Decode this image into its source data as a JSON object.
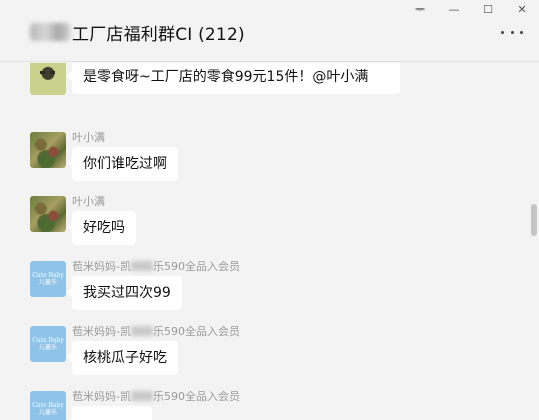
{
  "window": {
    "pin_glyph": "ᆓ",
    "minimize_glyph": "—",
    "maximize_glyph": "☐",
    "close_glyph": "✕"
  },
  "header": {
    "title": "工厂店福利群CI (212)",
    "more_icon": "more-dots-icon"
  },
  "messages": [
    {
      "sender": "",
      "avatar": "green-face-avatar",
      "text": "是零食呀~工厂店的零食99元15件！@叶小满"
    },
    {
      "sender": "叶小满",
      "avatar": "photo-avatar",
      "text": "你们谁吃过啊"
    },
    {
      "sender": "叶小满",
      "avatar": "photo-avatar",
      "text": "好吃吗"
    },
    {
      "sender_prefix": "苞米妈妈-凯",
      "sender_suffix": "乐590全品入会员",
      "avatar": "blue-logo-avatar",
      "avatar_text_1": "Cute Baby",
      "avatar_text_2": "儿童乐",
      "text": "我买过四次99"
    },
    {
      "sender_prefix": "苞米妈妈-凯",
      "sender_suffix": "乐590全品入会员",
      "avatar": "blue-logo-avatar",
      "avatar_text_1": "Cute Baby",
      "avatar_text_2": "儿童乐",
      "text": "核桃瓜子好吃"
    },
    {
      "sender_prefix": "苞米妈妈-凯",
      "sender_suffix": "乐590全品入会员",
      "avatar": "blue-logo-avatar",
      "avatar_text_1": "Cute Baby",
      "avatar_text_2": "儿童乐",
      "text": ""
    }
  ],
  "colors": {
    "background": "#f3f3f3",
    "bubble": "#ffffff",
    "sender_text": "#9a9a9a",
    "avatar_blue": "#8fc3e8"
  }
}
